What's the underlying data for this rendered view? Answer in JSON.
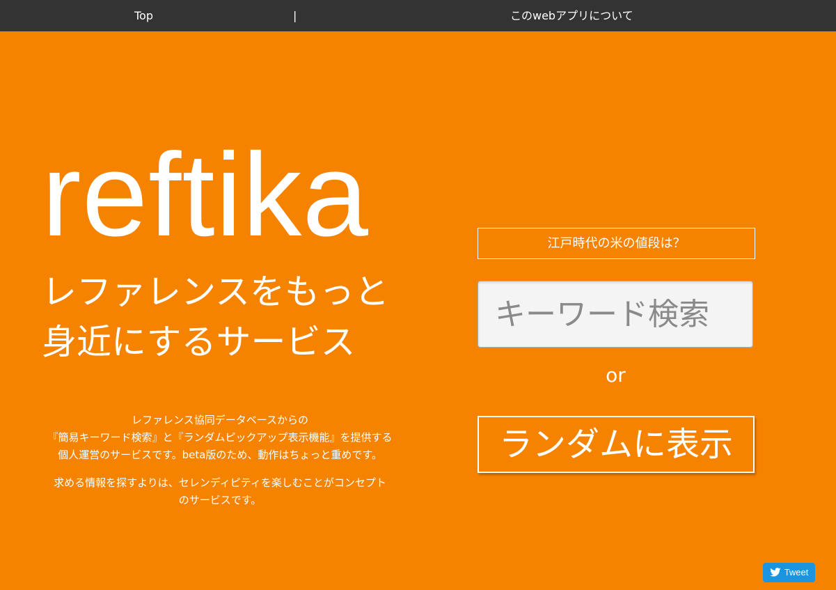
{
  "nav": {
    "top_label": "Top",
    "separator": "|",
    "about_label": "このwebアプリについて"
  },
  "hero": {
    "logo": "reftika",
    "tagline_line1": "レファレンスをもっと",
    "tagline_line2": "身近にするサービス",
    "description": {
      "line1": "レファレンス協同データベースからの",
      "line2": "『簡易キーワード検索』と『ランダムピックアップ表示機能』を提供する",
      "line3": "個人運営のサービスです。beta版のため、動作はちょっと重めです。",
      "line4": "求める情報を探すよりは、セレンディピティを楽しむことがコンセプト",
      "line5": "のサービスです。"
    }
  },
  "actions": {
    "question": "江戸時代の米の値段は？",
    "search_placeholder": "キーワード検索",
    "or": "or",
    "random_button": "ランダムに表示"
  },
  "share": {
    "tweet_label": "Tweet",
    "icon": "twitter-bird-icon"
  },
  "colors": {
    "background": "#f68300",
    "navbar": "#333333",
    "tweet": "#1b95e0"
  }
}
